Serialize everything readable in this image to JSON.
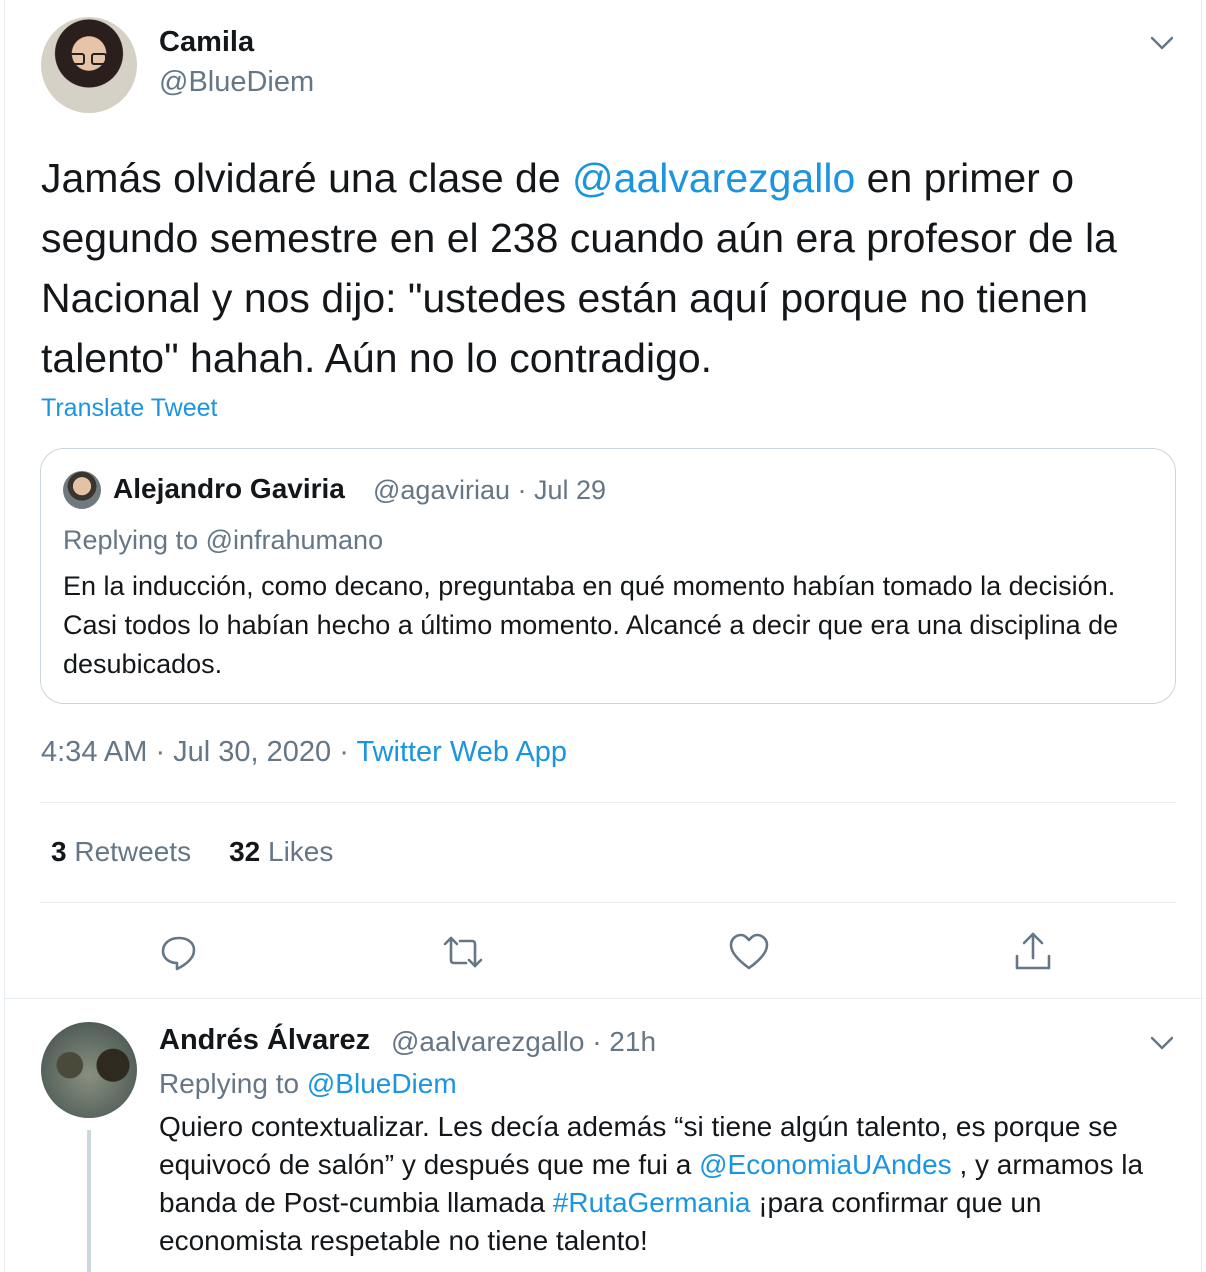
{
  "main_tweet": {
    "author_name": "Camila",
    "author_handle": "@BlueDiem",
    "text_before_mention": "Jamás olvidaré una clase de ",
    "mention": "@aalvarezgallo",
    "text_after_mention": "  en primer o segundo semestre en el 238 cuando aún era profesor de la Nacional y nos dijo: \"ustedes están aquí porque no tienen talento\" hahah. Aún no lo contradigo.",
    "translate_label": "Translate Tweet",
    "time": "4:34 AM · Jul 30, 2020 · ",
    "source": "Twitter Web App",
    "retweets_count": "3",
    "retweets_label": "Retweets",
    "likes_count": "32",
    "likes_label": "Likes"
  },
  "quoted_tweet": {
    "author_name": "Alejandro Gaviria",
    "meta": "@agaviriau · Jul 29",
    "replying_to": "Replying to @infrahumano",
    "text": "En la inducción, como decano, preguntaba en qué momento habían tomado la decisión. Casi todos lo habían hecho a último momento. Alcancé a decir que era una disciplina de desubicados."
  },
  "reply_tweet": {
    "author_name": "Andrés Álvarez",
    "meta": "@aalvarezgallo · 21h",
    "replying_prefix": "Replying to ",
    "replying_handle": "@BlueDiem",
    "text_1": "Quiero contextualizar. Les decía además “si tiene algún talento, es porque se equivocó de salón” y después que me fui a ",
    "mention": "@EconomiaUAndes",
    "text_2": " , y armamos la banda de Post-cumbia llamada ",
    "hashtag": "#RutaGermania",
    "text_3": " ¡para confirmar que un economista respetable no tiene talento!"
  },
  "icons": {
    "reply": "reply-icon",
    "retweet": "retweet-icon",
    "like": "heart-icon",
    "share": "share-icon",
    "more": "chevron-down-icon"
  },
  "colors": {
    "link": "#1b95e0",
    "secondary_text": "#657786",
    "border": "#e6ecf0"
  }
}
